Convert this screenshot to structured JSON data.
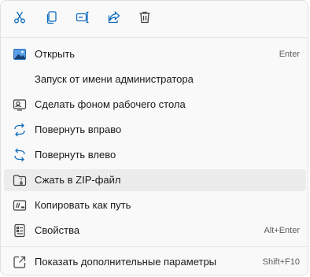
{
  "toolbar": {
    "icons": [
      "cut-icon",
      "copy-icon",
      "rename-icon",
      "share-icon",
      "delete-icon"
    ]
  },
  "items": [
    {
      "label": "Открыть",
      "shortcut": "Enter",
      "icon": "image-icon"
    },
    {
      "label": "Запуск от имени администратора",
      "shortcut": "",
      "icon": ""
    },
    {
      "label": "Сделать фоном рабочего стола",
      "shortcut": "",
      "icon": "wallpaper-icon"
    },
    {
      "label": "Повернуть вправо",
      "shortcut": "",
      "icon": "rotate-right-icon"
    },
    {
      "label": "Повернуть влево",
      "shortcut": "",
      "icon": "rotate-left-icon"
    },
    {
      "label": "Сжать в ZIP-файл",
      "shortcut": "",
      "icon": "zip-icon"
    },
    {
      "label": "Копировать как путь",
      "shortcut": "",
      "icon": "copy-path-icon"
    },
    {
      "label": "Свойства",
      "shortcut": "Alt+Enter",
      "icon": "properties-icon"
    },
    {
      "label": "Показать дополнительные параметры",
      "shortcut": "Shift+F10",
      "icon": "more-options-icon"
    }
  ],
  "colors": {
    "accent": "#0f6cbd",
    "icon": "#404040",
    "hover": "#ececec"
  }
}
